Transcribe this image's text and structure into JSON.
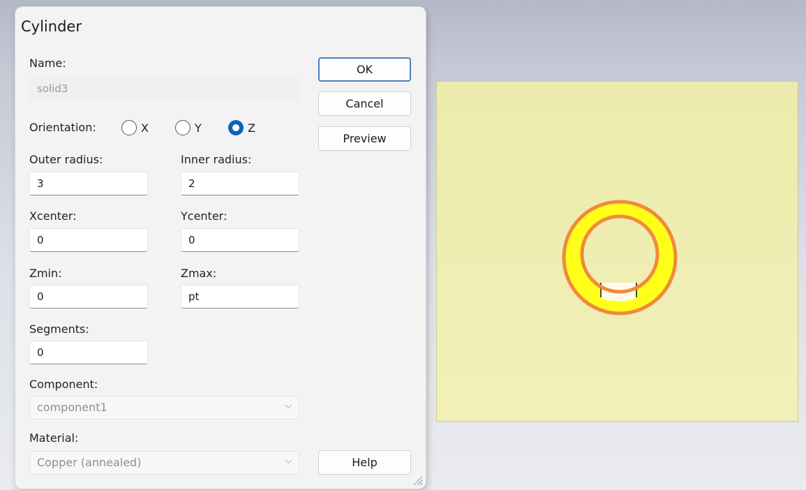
{
  "dialog": {
    "title": "Cylinder",
    "name_label": "Name:",
    "name_value": "solid3",
    "orientation_label": "Orientation:",
    "orientation_options": [
      "X",
      "Y",
      "Z"
    ],
    "orientation_selected": "Z",
    "outer_radius_label": "Outer radius:",
    "outer_radius_value": "3",
    "inner_radius_label": "Inner radius:",
    "inner_radius_value": "2",
    "xcenter_label": "Xcenter:",
    "xcenter_value": "0",
    "ycenter_label": "Ycenter:",
    "ycenter_value": "0",
    "zmin_label": "Zmin:",
    "zmin_value": "0",
    "zmax_label": "Zmax:",
    "zmax_value": "pt",
    "segments_label": "Segments:",
    "segments_value": "0",
    "component_label": "Component:",
    "component_value": "component1",
    "material_label": "Material:",
    "material_value": "Copper (annealed)",
    "buttons": {
      "ok": "OK",
      "cancel": "Cancel",
      "preview": "Preview",
      "help": "Help"
    }
  },
  "colors": {
    "ring_fill": "#ffff1a",
    "ring_outline": "#f08a3c",
    "workplane": "#f0eeb4",
    "selected_radio": "#0a63b8"
  },
  "icons": {
    "dropdown": "chevron-down-icon",
    "resize": "resize-grip-icon"
  }
}
